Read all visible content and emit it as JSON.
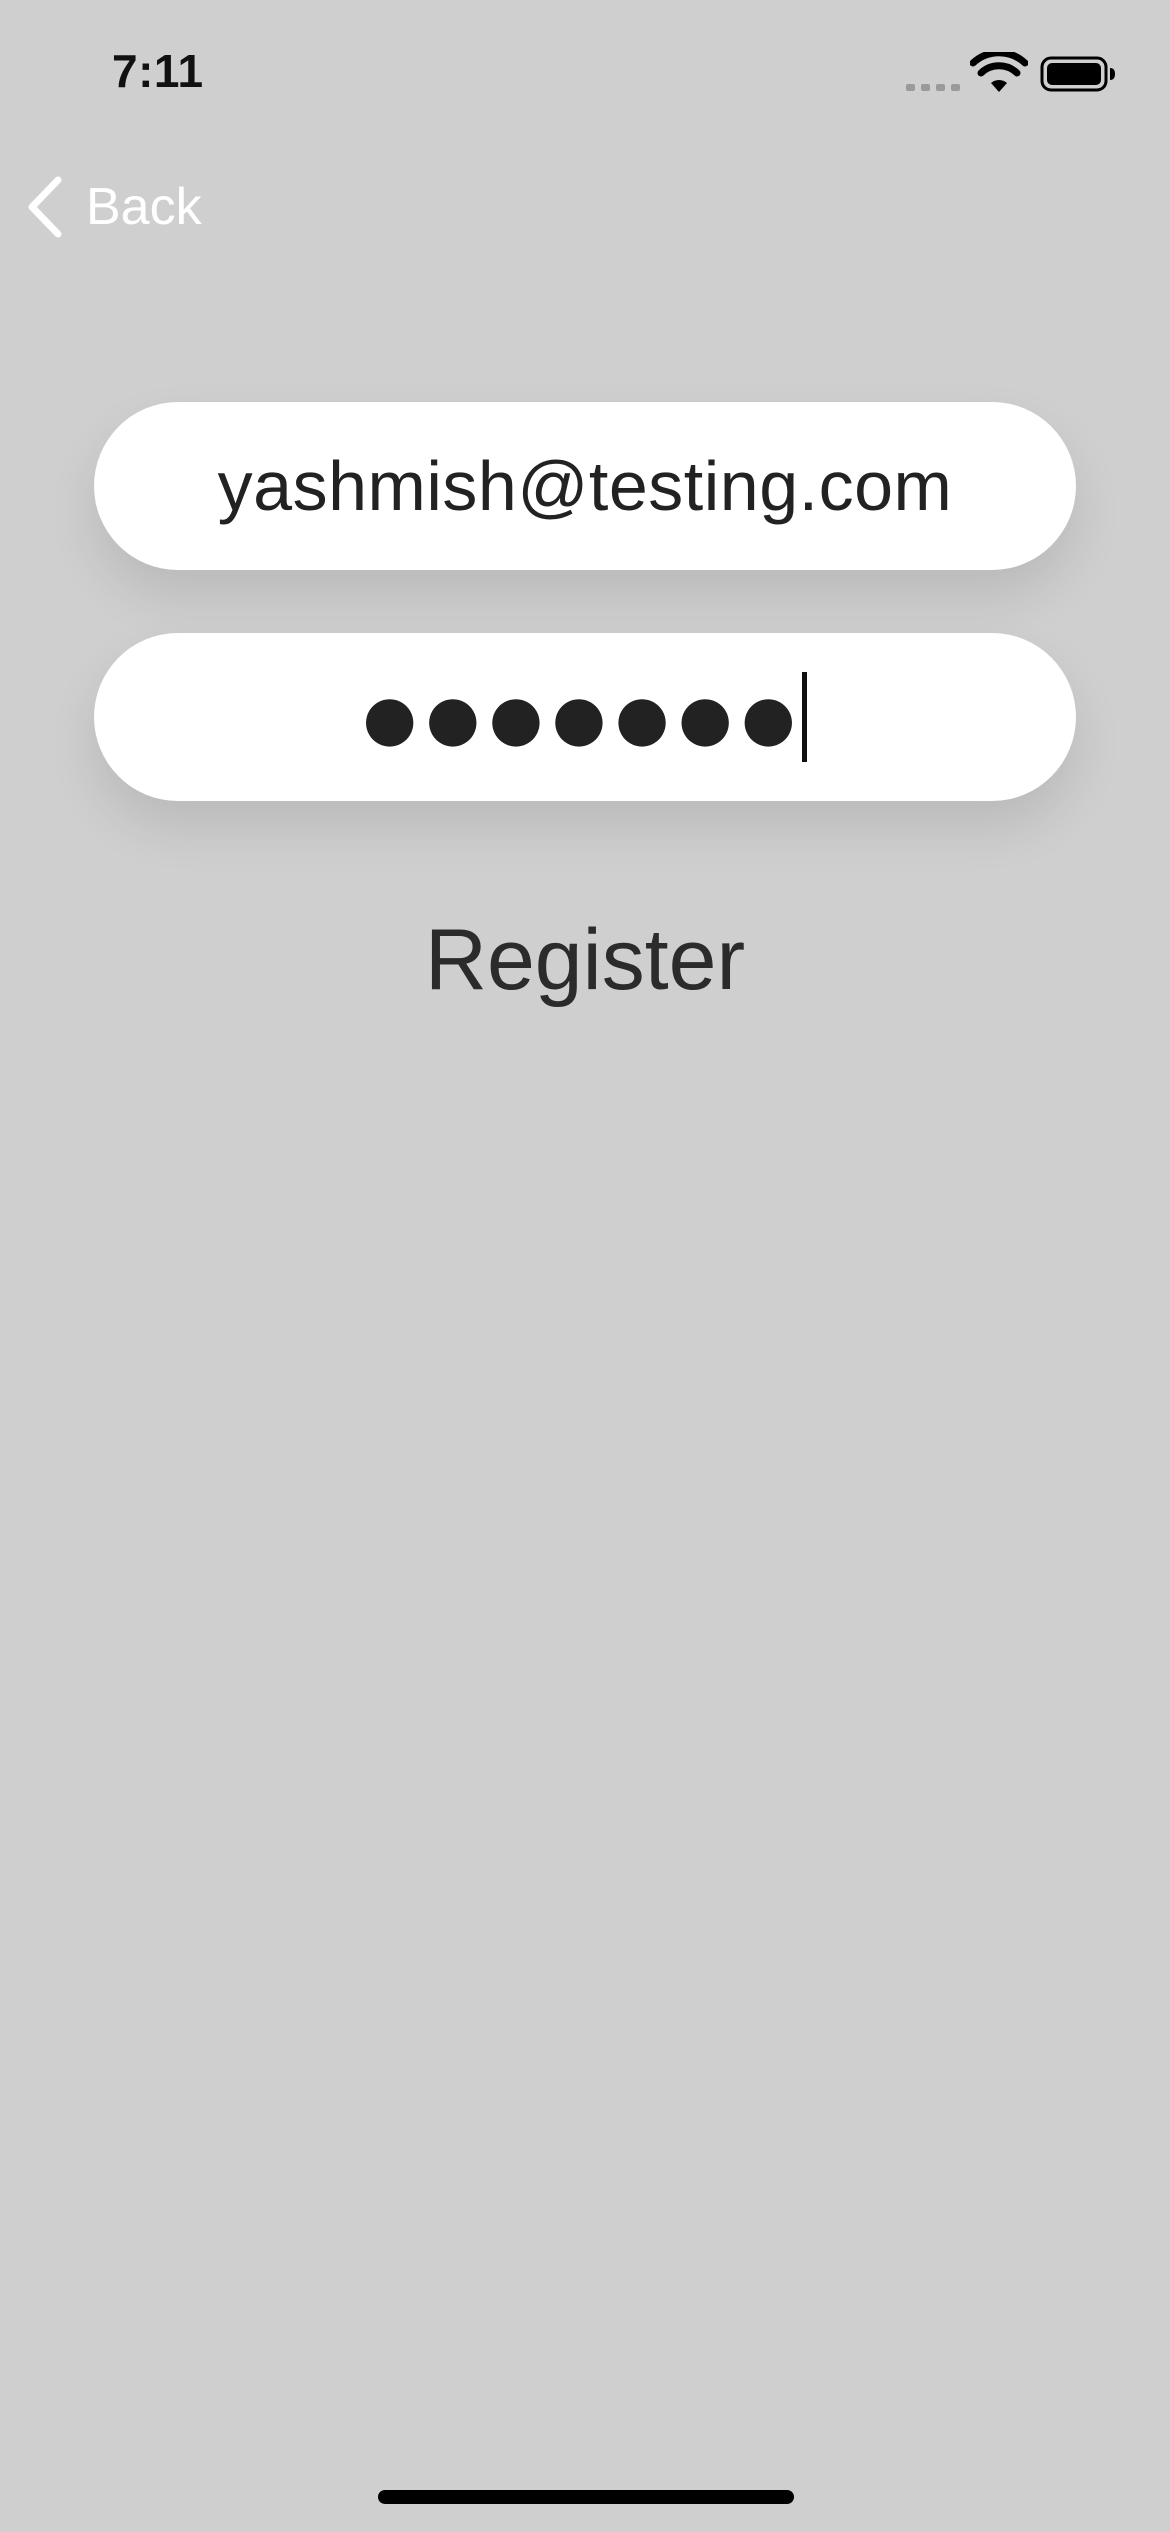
{
  "status_bar": {
    "time": "7:11",
    "icons": [
      "signal-icon",
      "wifi-icon",
      "battery-icon"
    ]
  },
  "nav": {
    "back_label": "Back",
    "back_icon": "chevron-left-icon"
  },
  "form": {
    "email_value": "yashmish@testing.com",
    "password_masked": "●●●●●●●",
    "register_label": "Register"
  },
  "colors": {
    "background": "#d0cfd0",
    "field_background": "#ffffff",
    "text_primary": "#222222",
    "nav_tint": "#ffffff"
  }
}
